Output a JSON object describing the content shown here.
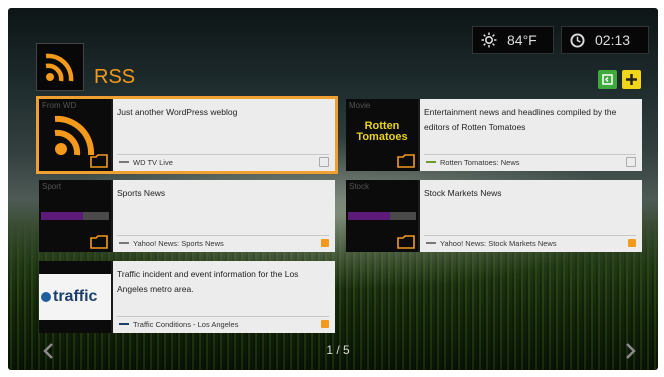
{
  "header": {
    "title": "RSS"
  },
  "status": {
    "temperature": "84°F",
    "time": "02:13"
  },
  "icons": {
    "weather": "sun-icon",
    "clock": "clock-icon",
    "rss": "rss-icon",
    "back": "back-icon",
    "add": "add-icon",
    "folder": "folder-icon",
    "prev": "chevron-left-icon",
    "next": "chevron-right-icon"
  },
  "colors": {
    "accent": "#f39a1c",
    "selection": "#f0a030",
    "back_button": "#3eaa3c",
    "add_button": "#f0d51a"
  },
  "feeds": [
    {
      "tag": "From WD",
      "description": "Just another WordPress weblog",
      "source": "WD TV Live",
      "thumb_text": "",
      "pinned": false,
      "selected": true
    },
    {
      "tag": "Movie",
      "description": "Entertainment news and headlines compiled by the editors of Rotten Tomatoes",
      "source": "Rotten Tomatoes: News",
      "thumb_text": "Rotten Tomatoes",
      "pinned": false,
      "selected": false
    },
    {
      "tag": "Sport",
      "description": "Sports News",
      "source": "Yahoo! News: Sports News",
      "thumb_text": "",
      "pinned": true,
      "selected": false
    },
    {
      "tag": "Stock",
      "description": "Stock Markets News",
      "source": "Yahoo! News: Stock Markets News",
      "thumb_text": "",
      "pinned": true,
      "selected": false
    },
    {
      "tag": "",
      "description": "Traffic incident and event information for the Los Angeles metro area.",
      "source": "Traffic Conditions - Los Angeles",
      "thumb_text": "traffic",
      "pinned": true,
      "selected": false
    }
  ],
  "pagination": {
    "label": "1 / 5"
  }
}
